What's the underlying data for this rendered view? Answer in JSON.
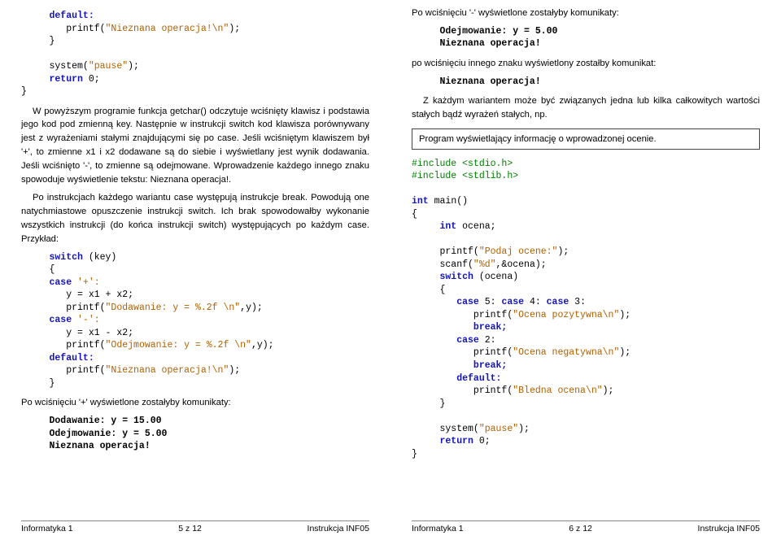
{
  "left": {
    "codeTop": {
      "l1a": "     default:",
      "l1b": "        printf(",
      "l1c": "\"Nieznana operacja!\\n\"",
      "l1d": ");",
      "l2": "     }",
      "l3a": "     system(",
      "l3b": "\"pause\"",
      "l3c": ");",
      "l4a": "     return",
      "l4b": " 0;",
      "l5": "}"
    },
    "para1": "W powyższym programie funkcja getchar() odczytuje wciśnięty klawisz i podstawia jego kod pod zmienną key. Następnie w instrukcji switch kod klawisza porównywany jest z wyrażeniami stałymi znajdującymi się po case. Jeśli wciśniętym klawiszem był '+', to zmienne x1 i x2 dodawane są do siebie i wyświetlany jest wynik dodawania. Jeśli wciśnięto '-', to zmienne są odejmowane. Wprowadzenie każdego innego znaku spowoduje wyświetlenie tekstu: Nieznana operacja!.",
    "para2": "Po instrukcjach każdego wariantu case występują instrukcje break. Powodują one natychmiastowe opuszczenie instrukcji switch. Ich brak spowodowałby wykonanie wszystkich instrukcji (do końca instrukcji switch) występujących po każdym case. Przykład:",
    "codeMid": {
      "l1a": "     switch",
      "l1b": " (key)",
      "l2": "     {",
      "l3a": "     case",
      "l3b": " '+':",
      "l4": "        y = x1 + x2;",
      "l5a": "        printf(",
      "l5b": "\"Dodawanie: y = %.2f \\n\"",
      "l5c": ",y);",
      "l6a": "     case",
      "l6b": " '-':",
      "l7": "        y = x1 - x2;",
      "l8a": "        printf(",
      "l8b": "\"Odejmowanie: y = %.2f \\n\"",
      "l8c": ",y);",
      "l9": "     default:",
      "l10a": "        printf(",
      "l10b": "\"Nieznana operacja!\\n\"",
      "l10c": ");",
      "l11": "     }"
    },
    "outLabel1": "Po wciśnięciu '+' wyświetlone zostałyby komunikaty:",
    "out1": "     Dodawanie: y = 15.00\n     Odejmowanie: y = 5.00\n     Nieznana operacja!",
    "footer": {
      "l": "Informatyka 1",
      "c": "5 z 12",
      "r": "Instrukcja INF05"
    }
  },
  "right": {
    "outLabel2": "Po wciśnięciu '-' wyświetlone zostałyby komunikaty:",
    "out2": "     Odejmowanie: y = 5.00\n     Nieznana operacja!",
    "outLabel3": "po wciśnięciu innego znaku wyświetlony zostałby komunikat:",
    "out3": "     Nieznana operacja!",
    "para3": "Z każdym wariantem może być związanych jedna lub kilka całkowitych wartości stałych bądź wyrażeń stałych, np.",
    "boxText": "Program wyświetlający informację o wprowadzonej ocenie.",
    "codeProg": {
      "l1": "#include <stdio.h>",
      "l2": "#include <stdlib.h>",
      "l3": "",
      "l4a": "int",
      "l4b": " main()",
      "l5": "{",
      "l6a": "     int",
      "l6b": " ocena;",
      "l7": "",
      "l8a": "     printf(",
      "l8b": "\"Podaj ocene:\"",
      "l8c": ");",
      "l9a": "     scanf(",
      "l9b": "\"%d\"",
      "l9c": ",&ocena);",
      "l10a": "     switch",
      "l10b": " (ocena)",
      "l11": "     {",
      "l12a": "        case",
      "l12b": " 5: ",
      "l12c": "case",
      "l12d": " 4: ",
      "l12e": "case",
      "l12f": " 3:",
      "l13a": "           printf(",
      "l13b": "\"Ocena pozytywna\\n\"",
      "l13c": ");",
      "l14": "           break;",
      "l15a": "        case",
      "l15b": " 2:",
      "l16a": "           printf(",
      "l16b": "\"Ocena negatywna\\n\"",
      "l16c": ");",
      "l17": "           break;",
      "l18": "        default:",
      "l19a": "           printf(",
      "l19b": "\"Bledna ocena\\n\"",
      "l19c": ");",
      "l20": "     }",
      "l21": "",
      "l22a": "     system(",
      "l22b": "\"pause\"",
      "l22c": ");",
      "l23a": "     return",
      "l23b": " 0;",
      "l24": "}"
    },
    "footer": {
      "l": "Informatyka 1",
      "c": "6 z 12",
      "r": "Instrukcja INF05"
    }
  }
}
